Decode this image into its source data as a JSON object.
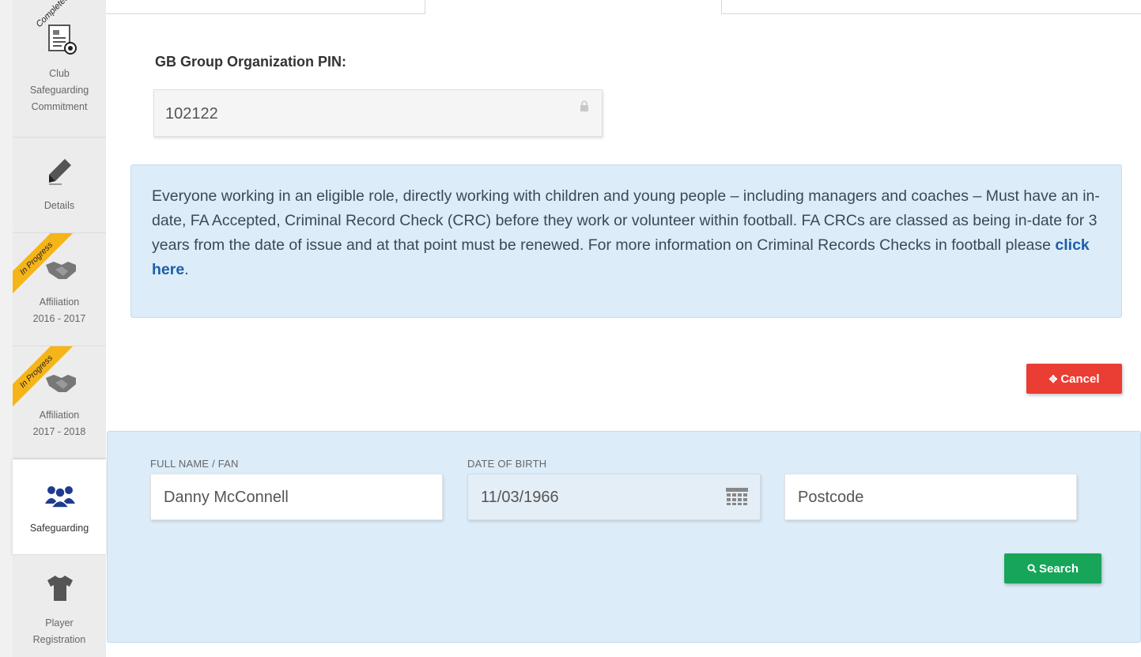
{
  "sidebar": {
    "items": [
      {
        "label_lines": [
          "Club",
          "Safeguarding",
          "Commitment"
        ],
        "status": "Completed",
        "icon": "document-football-icon"
      },
      {
        "label_lines": [
          "Details"
        ],
        "status": "",
        "icon": "pencil-icon"
      },
      {
        "label_lines": [
          "Affiliation",
          "2016 - 2017"
        ],
        "status": "In Progress",
        "icon": "handshake-icon"
      },
      {
        "label_lines": [
          "Affiliation",
          "2017 - 2018"
        ],
        "status": "In Progress",
        "icon": "handshake-icon"
      },
      {
        "label_lines": [
          "Safeguarding"
        ],
        "status": "",
        "icon": "people-group-icon",
        "active": true
      },
      {
        "label_lines": [
          "Player",
          "Registration"
        ],
        "status": "",
        "icon": "shirt-icon"
      }
    ]
  },
  "org_pin": {
    "label": "GB Group Organization PIN:",
    "value": "102122"
  },
  "info": {
    "text": "Everyone working in an eligible role, directly working with children and young people – including managers and coaches – Must have an in-date, FA Accepted, Criminal Record Check (CRC) before they work or volunteer within football. FA CRCs are classed as being in-date for 3 years from the date of issue and at that point must be renewed. For more information on Criminal Records Checks in football please ",
    "link_text": "click here",
    "trailing": "."
  },
  "cancel_label": "Cancel",
  "search": {
    "name_label": "FULL NAME / FAN",
    "name_value": "Danny McConnell",
    "dob_label": "DATE OF BIRTH",
    "dob_value": "11/03/1966",
    "postcode_placeholder": "Postcode",
    "button_label": "Search"
  },
  "colors": {
    "info_bg": "#dcecf8",
    "cancel": "#ea3d33",
    "search": "#17a55a",
    "ribbon": "#f5b418",
    "link": "#1d5ea8"
  }
}
